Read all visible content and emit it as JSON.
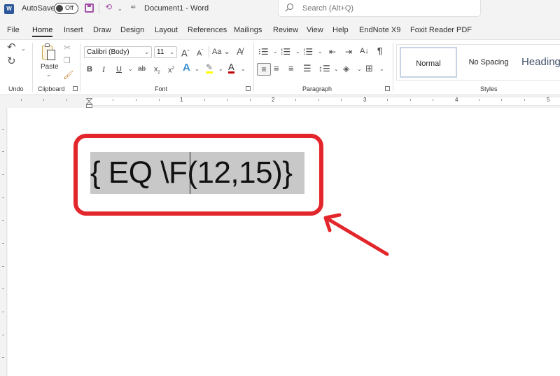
{
  "titlebar": {
    "app_icon": "word-icon",
    "autosave_label": "AutoSave",
    "autosave_state": "Off",
    "doc_title": "Document1  -  Word",
    "search_placeholder": "Search (Alt+Q)"
  },
  "tabs": [
    {
      "label": "File",
      "active": false
    },
    {
      "label": "Home",
      "active": true
    },
    {
      "label": "Insert",
      "active": false
    },
    {
      "label": "Draw",
      "active": false
    },
    {
      "label": "Design",
      "active": false
    },
    {
      "label": "Layout",
      "active": false
    },
    {
      "label": "References",
      "active": false
    },
    {
      "label": "Mailings",
      "active": false
    },
    {
      "label": "Review",
      "active": false
    },
    {
      "label": "View",
      "active": false
    },
    {
      "label": "Help",
      "active": false
    },
    {
      "label": "EndNote X9",
      "active": false
    },
    {
      "label": "Foxit Reader PDF",
      "active": false
    }
  ],
  "ribbon": {
    "undo_group": {
      "label": "Undo"
    },
    "clipboard_group": {
      "label": "Clipboard",
      "paste_label": "Paste"
    },
    "font_group": {
      "label": "Font",
      "font_name": "Calibri (Body)",
      "font_size": "11",
      "bold": "B",
      "italic": "I",
      "underline": "U",
      "strikethrough": "ab",
      "case_label": "Aa",
      "grow": "A",
      "shrink": "A",
      "text_effects": "A",
      "font_color": "A",
      "font_color_hex": "#c00000",
      "highlight_color_hex": "#ffff00"
    },
    "paragraph_group": {
      "label": "Paragraph",
      "pilcrow": "¶"
    },
    "styles_group": {
      "label": "Styles",
      "styles": [
        "Normal",
        "No Spacing",
        "Heading"
      ]
    }
  },
  "ruler": {
    "numbers": [
      "1",
      "2",
      "3",
      "4",
      "5"
    ]
  },
  "document": {
    "field_code": "{ EQ \\F(12,15)}",
    "annotation_color": "#e3262b",
    "selection_color": "#c8c8c8"
  }
}
